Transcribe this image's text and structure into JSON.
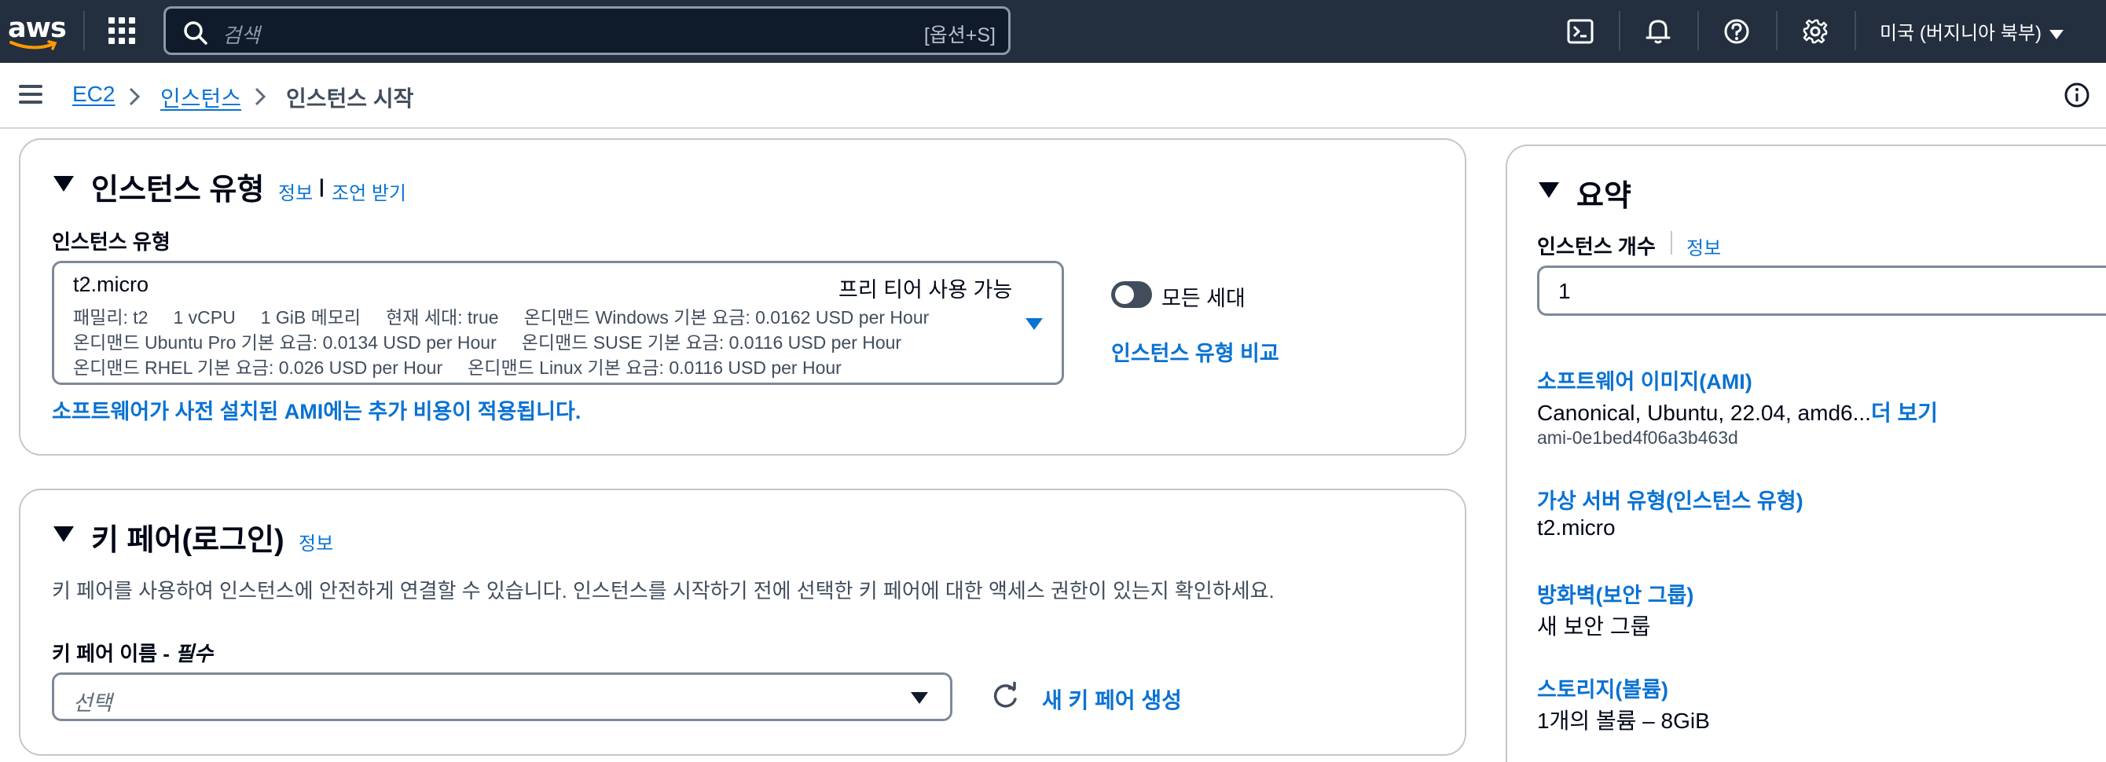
{
  "topnav": {
    "logo_text": "aws",
    "search_placeholder": "검색",
    "search_shortcut": "[옵션+S]",
    "region": "미국 (버지니아 북부)",
    "icons": [
      "cloudshell-icon",
      "bell-icon",
      "help-icon",
      "gear-icon"
    ]
  },
  "breadcrumb": {
    "items": [
      {
        "label": "EC2",
        "link": true
      },
      {
        "label": "인스턴스",
        "link": true
      },
      {
        "label": "인스턴스 시작",
        "link": false
      }
    ]
  },
  "instance_type": {
    "title": "인스턴스 유형",
    "info_link": "정보",
    "separator": "|",
    "advice_link": "조언 받기",
    "field_label": "인스턴스 유형",
    "selected": {
      "name": "t2.micro",
      "badge": "프리 티어 사용 가능",
      "line1": [
        "패밀리: t2",
        "1 vCPU",
        "1 GiB 메모리",
        "현재 세대: true",
        "온디맨드 Windows 기본 요금: 0.0162 USD per Hour"
      ],
      "line2": [
        "온디맨드 Ubuntu Pro 기본 요금: 0.0134 USD per Hour",
        "온디맨드 SUSE 기본 요금: 0.0116 USD per Hour"
      ],
      "line3": [
        "온디맨드 RHEL 기본 요금: 0.026 USD per Hour",
        "온디맨드 Linux 기본 요금: 0.0116 USD per Hour"
      ]
    },
    "toggle_label": "모든 세대",
    "toggle_on": false,
    "compare_link": "인스턴스 유형 비교",
    "ami_note": "소프트웨어가 사전 설치된 AMI에는 추가 비용이 적용됩니다."
  },
  "key_pair": {
    "title": "키 페어(로그인)",
    "info_link": "정보",
    "description": "키 페어를 사용하여 인스턴스에 안전하게 연결할 수 있습니다. 인스턴스를 시작하기 전에 선택한 키 페어에 대한 액세스 권한이 있는지 확인하세요.",
    "field_label": "키 페어 이름 - ",
    "field_required": "필수",
    "placeholder": "선택",
    "new_key_link": "새 키 페어 생성"
  },
  "summary": {
    "title": "요약",
    "count_label": "인스턴스 개수",
    "count_info": "정보",
    "count_value": "1",
    "ami_link": "소프트웨어 이미지(AMI)",
    "ami_value": "Canonical, Ubuntu, 22.04, amd6...",
    "ami_more": "더 보기",
    "ami_id": "ami-0e1bed4f06a3b463d",
    "vserver_link": "가상 서버 유형(인스턴스 유형)",
    "vserver_value": "t2.micro",
    "firewall_link": "방화벽(보안 그룹)",
    "firewall_value": "새 보안 그룹",
    "storage_link": "스토리지(볼륨)",
    "storage_value": "1개의 볼륨 – 8GiB"
  },
  "colors": {
    "nav_bg": "#232f3e",
    "link": "#0972d3",
    "text": "#000716",
    "border": "#c6c6cd"
  }
}
